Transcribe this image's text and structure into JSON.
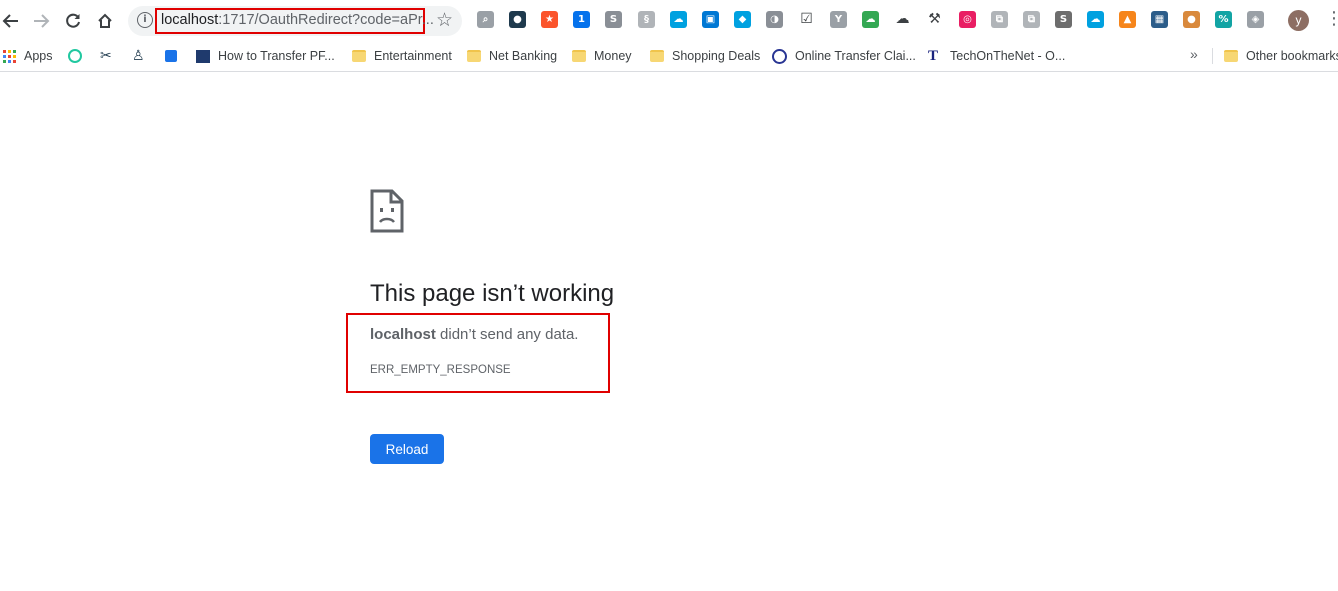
{
  "toolbar": {
    "url_host": "localhost",
    "url_rest": ":1717/OauthRedirect?code=aPr...",
    "avatar_letter": "y",
    "extensions": [
      {
        "name": "zoom-ext-icon",
        "color": "#9aa0a6",
        "glyph": "⌕"
      },
      {
        "name": "globe-ext-icon",
        "color": "#1f3a4d",
        "glyph": "●"
      },
      {
        "name": "brave-ext-icon",
        "color": "#fb542b",
        "glyph": "★"
      },
      {
        "name": "onepassword-ext-icon",
        "color": "#0572ec",
        "glyph": "1"
      },
      {
        "name": "skype-ext-icon",
        "color": "#8a8f96",
        "glyph": "S"
      },
      {
        "name": "swirl-ext-icon",
        "color": "#b0b4b8",
        "glyph": "§"
      },
      {
        "name": "salesforce-ext-icon",
        "color": "#00a1e0",
        "glyph": "☁"
      },
      {
        "name": "window-ext-icon",
        "color": "#0078d4",
        "glyph": "▣"
      },
      {
        "name": "tag-ext-icon",
        "color": "#00a1e0",
        "glyph": "◆"
      },
      {
        "name": "face-ext-icon",
        "color": "#8a8f96",
        "glyph": "◑"
      },
      {
        "name": "check-ext-icon",
        "color": "#ffffff",
        "glyph": "☑"
      },
      {
        "name": "y-ext-icon",
        "color": "#9aa0a6",
        "glyph": "Y"
      },
      {
        "name": "cloud-color-ext-icon",
        "color": "#34a853",
        "glyph": "☁"
      },
      {
        "name": "cloud-outline-ext-icon",
        "color": "#ffffff",
        "glyph": "☁"
      },
      {
        "name": "wrench-ext-icon",
        "color": "#ffffff",
        "glyph": "⚒"
      },
      {
        "name": "ring-ext-icon",
        "color": "#e91e63",
        "glyph": "◎"
      },
      {
        "name": "translate-ext-icon",
        "color": "#b0b4b8",
        "glyph": "⧉"
      },
      {
        "name": "translate2-ext-icon",
        "color": "#b0b4b8",
        "glyph": "⧉"
      },
      {
        "name": "s-ext-icon",
        "color": "#6d6d6d",
        "glyph": "S"
      },
      {
        "name": "cloud-sync-ext-icon",
        "color": "#00a1e0",
        "glyph": "☁"
      },
      {
        "name": "metamask-ext-icon",
        "color": "#f6851b",
        "glyph": "▲"
      },
      {
        "name": "app-ext-icon",
        "color": "#2c5d8a",
        "glyph": "▦"
      },
      {
        "name": "cookie-ext-icon",
        "color": "#d9893c",
        "glyph": "●"
      },
      {
        "name": "percent-ext-icon",
        "color": "#12a4a4",
        "glyph": "%"
      },
      {
        "name": "shield-ext-icon",
        "color": "#9aa0a6",
        "glyph": "◈"
      }
    ]
  },
  "bookmarks": {
    "apps": "Apps",
    "items": [
      "How to Transfer PF...",
      "Entertainment",
      "Net Banking",
      "Money",
      "Shopping Deals",
      "Online Transfer Clai...",
      "TechOnTheNet - O..."
    ],
    "other": "Other bookmarks"
  },
  "error": {
    "title": "This page isn’t working",
    "host": "localhost",
    "message": " didn’t send any data.",
    "code": "ERR_EMPTY_RESPONSE",
    "reload_label": "Reload"
  }
}
